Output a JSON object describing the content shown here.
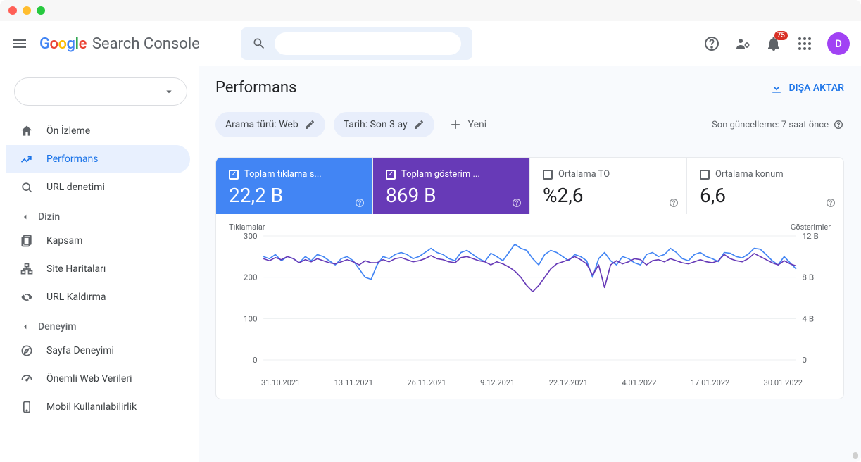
{
  "header": {
    "product": "Search Console",
    "badge_count": "75",
    "avatar_initial": "D"
  },
  "sidebar": {
    "overview": "Ön İzleme",
    "performance": "Performans",
    "url_inspect": "URL denetimi",
    "sec_index": "Dizin",
    "coverage": "Kapsam",
    "sitemaps": "Site Haritaları",
    "removals": "URL Kaldırma",
    "sec_experience": "Deneyim",
    "page_exp": "Sayfa Deneyimi",
    "core_web": "Önemli Web Verileri",
    "mobile": "Mobil Kullanılabilirlik"
  },
  "page": {
    "title": "Performans",
    "export": "DIŞA AKTAR",
    "last_update": "Son güncelleme: 7 saat önce"
  },
  "filters": {
    "search_type": "Arama türü: Web",
    "date": "Tarih: Son 3 ay",
    "new": "Yeni"
  },
  "metrics": {
    "clicks_label": "Toplam tıklama s...",
    "clicks_value": "22,2 B",
    "impr_label": "Toplam gösterim ...",
    "impr_value": "869 B",
    "ctr_label": "Ortalama TO",
    "ctr_value": "%2,6",
    "pos_label": "Ortalama konum",
    "pos_value": "6,6"
  },
  "chart_labels": {
    "left": "Tıklamalar",
    "right": "Gösterimler"
  },
  "chart_data": {
    "type": "line",
    "title": "",
    "xlabel": "",
    "y_left_label": "Tıklamalar",
    "y_right_label": "Gösterimler",
    "y_left_ticks": [
      0,
      100,
      200,
      300
    ],
    "y_right_ticks": [
      "0",
      "4 B",
      "8 B",
      "12 B"
    ],
    "left_range": [
      0,
      300
    ],
    "right_range": [
      0,
      12000
    ],
    "categories": [
      "31.10.2021",
      "13.11.2021",
      "26.11.2021",
      "9.12.2021",
      "22.12.2021",
      "4.01.2022",
      "17.01.2022",
      "30.01.2022"
    ],
    "series": [
      {
        "name": "Tıklamalar",
        "axis": "left",
        "color": "#4285f4",
        "values": [
          250,
          245,
          255,
          240,
          250,
          245,
          235,
          250,
          240,
          255,
          250,
          240,
          230,
          245,
          250,
          240,
          220,
          200,
          195,
          230,
          250,
          245,
          255,
          260,
          255,
          245,
          250,
          260,
          270,
          260,
          255,
          245,
          240,
          260,
          265,
          255,
          245,
          238,
          258,
          250,
          240,
          260,
          280,
          270,
          265,
          245,
          230,
          255,
          265,
          260,
          250,
          240,
          255,
          250,
          240,
          200,
          245,
          260,
          240,
          230,
          250,
          245,
          235,
          230,
          255,
          260,
          250,
          255,
          270,
          260,
          245,
          240,
          255,
          260,
          250,
          245,
          238,
          260,
          258,
          250,
          247,
          256,
          270,
          268,
          255,
          240,
          230,
          250,
          235,
          220
        ]
      },
      {
        "name": "Gösterimler",
        "axis": "right",
        "color": "#673ab7",
        "values": [
          9800,
          9600,
          9900,
          9700,
          10000,
          9800,
          9400,
          9700,
          9500,
          9800,
          9600,
          9400,
          9300,
          9500,
          9700,
          9500,
          9200,
          9600,
          9400,
          9400,
          9700,
          9500,
          9800,
          9900,
          9700,
          9500,
          9600,
          9800,
          10100,
          9800,
          9700,
          9500,
          9400,
          9900,
          10000,
          9800,
          9600,
          9500,
          9200,
          9500,
          9300,
          9000,
          8600,
          8000,
          7200,
          6600,
          7200,
          8000,
          8800,
          9300,
          9500,
          9700,
          10000,
          9700,
          9300,
          8200,
          9200,
          7000,
          9200,
          9600,
          9300,
          9500,
          9800,
          9700,
          9200,
          9600,
          9700,
          9500,
          9800,
          9600,
          9400,
          9300,
          9500,
          9700,
          9500,
          9400,
          9600,
          10200,
          9800,
          9600,
          9500,
          9800,
          10300,
          10000,
          9700,
          9400,
          9200,
          9600,
          9300,
          9100
        ]
      }
    ]
  }
}
